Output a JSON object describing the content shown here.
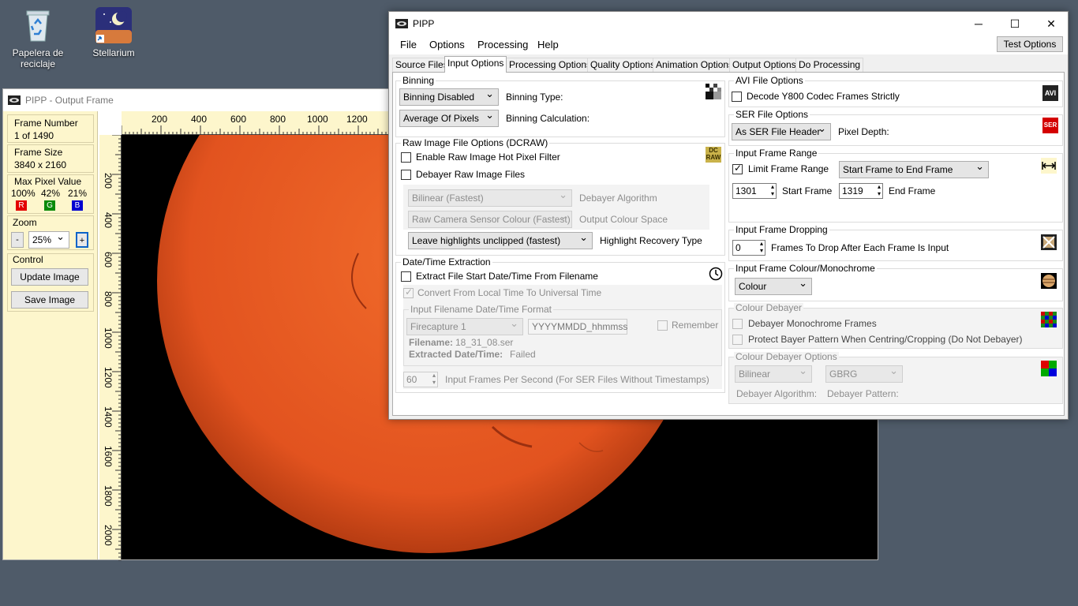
{
  "desktop": {
    "icons": [
      {
        "label_line1": "Papelera de",
        "label_line2": "reciclaje"
      },
      {
        "label_line1": "Stellarium",
        "label_line2": ""
      }
    ]
  },
  "output_window": {
    "title": "PIPP - Output Frame",
    "frame_number_label": "Frame Number",
    "frame_number_value": "1 of 1490",
    "frame_size_label": "Frame Size",
    "frame_size_value": "3840 x 2160",
    "max_pixel_label": "Max Pixel Value",
    "r_pct": "100%",
    "g_pct": "42%",
    "b_pct": "21%",
    "r": "R",
    "g": "G",
    "b": "B",
    "zoom_label": "Zoom",
    "zoom_minus": "-",
    "zoom_value": "25%",
    "zoom_plus": "+",
    "control_label": "Control",
    "update_image": "Update Image",
    "save_image": "Save Image",
    "ruler_top": [
      "200",
      "400",
      "600",
      "800",
      "1000",
      "1200"
    ],
    "ruler_left": [
      "200",
      "400",
      "600",
      "800",
      "1000",
      "1200",
      "1400",
      "1600",
      "1800",
      "2000"
    ],
    "sun_color": "#e2531f"
  },
  "pipp": {
    "title": "PIPP",
    "minimize": "─",
    "maximize": "☐",
    "close": "✕",
    "menu": [
      "File",
      "Options",
      "Processing",
      "Help"
    ],
    "test_options": "Test Options",
    "tabs": [
      "Source Files",
      "Input Options",
      "Processing Options",
      "Quality Options",
      "Animation Options",
      "Output Options",
      "Do Processing"
    ],
    "binning": {
      "title": "Binning",
      "type_value": "Binning Disabled",
      "type_label": "Binning Type:",
      "calc_value": "Average Of Pixels",
      "calc_label": "Binning Calculation:"
    },
    "raw": {
      "title": "Raw Image File Options (DCRAW)",
      "hot_pixel": "Enable Raw Image Hot Pixel Filter",
      "debayer": "Debayer Raw Image Files",
      "algo_value": "Bilinear (Fastest)",
      "algo_label": "Debayer Algorithm",
      "colour_value": "Raw Camera Sensor Colour (Fastest)",
      "colour_label": "Output Colour Space",
      "highlight_value": "Leave highlights unclipped (fastest)",
      "highlight_label": "Highlight Recovery Type",
      "icon_text": "DC RAW"
    },
    "datetime": {
      "title": "Date/Time Extraction",
      "extract": "Extract File Start Date/Time From Filename",
      "convert": "Convert From Local Time To Universal Time",
      "format_title": "Input Filename Date/Time Format",
      "format_value": "Firecapture 1",
      "format_text": "YYYYMMDD_hhmmss",
      "remember": "Remember",
      "filename_label": "Filename:",
      "filename_value": "18_31_08.ser",
      "extracted_label": "Extracted Date/Time:",
      "extracted_value": "Failed",
      "fps_value": "60",
      "fps_label": "Input Frames Per Second (For SER Files Without Timestamps)"
    },
    "avi": {
      "title": "AVI File Options",
      "decode": "Decode Y800 Codec Frames Strictly",
      "icon_text": "AVI"
    },
    "ser": {
      "title": "SER File Options",
      "depth_value": "As SER File Header",
      "depth_label": "Pixel Depth:",
      "icon_text": "SER"
    },
    "range": {
      "title": "Input Frame Range",
      "limit": "Limit Frame Range",
      "mode_value": "Start Frame to End Frame",
      "start_value": "1301",
      "start_label": "Start Frame",
      "end_value": "1319",
      "end_label": "End Frame"
    },
    "dropping": {
      "title": "Input Frame Dropping",
      "value": "0",
      "label": "Frames To Drop After Each Frame Is Input"
    },
    "colour_mono": {
      "title": "Input Frame Colour/Monochrome",
      "value": "Colour"
    },
    "colour_debayer": {
      "title": "Colour Debayer",
      "mono": "Debayer Monochrome Frames",
      "protect": "Protect Bayer Pattern When Centring/Cropping (Do Not Debayer)"
    },
    "debayer_options": {
      "title": "Colour Debayer Options",
      "algo_value": "Bilinear",
      "pattern_value": "GBRG",
      "algo_label": "Debayer Algorithm:",
      "pattern_label": "Debayer Pattern:"
    }
  }
}
